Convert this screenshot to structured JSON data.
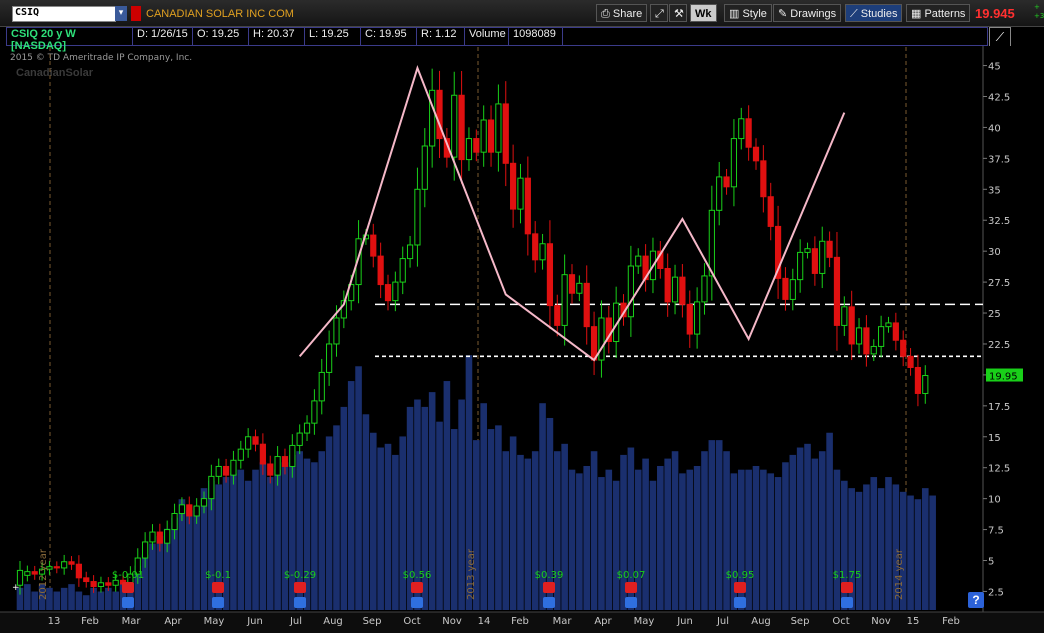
{
  "toolbar": {
    "symbol": "CSIQ",
    "company": "CANADIAN SOLAR INC COM",
    "share": "Share",
    "wk": "Wk",
    "style": "Style",
    "drawings": "Drawings",
    "studies": "Studies",
    "patterns": "Patterns",
    "last_price": "19.945",
    "right_tiny": "+\n+3"
  },
  "infobar": {
    "symbol": "CSIQ 20 y W [NASDAQ]",
    "date": "D: 1/26/15",
    "open": "O: 19.25",
    "high": "H: 20.37",
    "low": "L: 19.25",
    "close": "C: 19.95",
    "range": "R: 1.12",
    "vol_label": "Volume",
    "vol_value": "1098089"
  },
  "copyright": "2015 © TD Ameritrade IP Company, Inc.",
  "watermark": "CanadianSolar",
  "colors": {
    "up": "#19d019",
    "down": "#e01010",
    "volume": "#1a2f6e",
    "pattern": "#f5b8c8",
    "price_tag": "#19d019"
  },
  "chart_data": {
    "type": "candlestick",
    "ylim": [
      1.0,
      46.5
    ],
    "y_ticks": [
      "45",
      "42.5",
      "40",
      "37.5",
      "35",
      "32.5",
      "30",
      "27.5",
      "25",
      "22.5",
      "20",
      "17.5",
      "15",
      "12.5",
      "10",
      "7.5",
      "5",
      "2.5"
    ],
    "x_ticks": [
      "13",
      "Feb",
      "Mar",
      "Apr",
      "May",
      "Jun",
      "Jul",
      "Aug",
      "Sep",
      "Oct",
      "Nov",
      "14",
      "Feb",
      "Mar",
      "Apr",
      "May",
      "Jun",
      "Jul",
      "Aug",
      "Sep",
      "Oct",
      "Nov",
      "15",
      "Feb"
    ],
    "year_markers": [
      "2012 year",
      "2013 year",
      "2014 year"
    ],
    "current_price_label": "19.95",
    "candles": [
      [
        3.0,
        4.2
      ],
      [
        3.8,
        4.1
      ],
      [
        4.1,
        3.9
      ],
      [
        3.9,
        4.3
      ],
      [
        4.3,
        4.5
      ],
      [
        4.5,
        4.4
      ],
      [
        4.4,
        4.9
      ],
      [
        4.9,
        4.7
      ],
      [
        4.7,
        3.6
      ],
      [
        3.6,
        3.3
      ],
      [
        3.3,
        2.9
      ],
      [
        2.9,
        3.2
      ],
      [
        3.2,
        3.0
      ],
      [
        3.0,
        3.4
      ],
      [
        3.4,
        3.1
      ],
      [
        3.1,
        3.9
      ],
      [
        3.9,
        5.2
      ],
      [
        5.2,
        6.5
      ],
      [
        6.5,
        7.3
      ],
      [
        7.3,
        6.4
      ],
      [
        6.4,
        7.5
      ],
      [
        7.5,
        8.8
      ],
      [
        8.8,
        9.5
      ],
      [
        9.5,
        8.6
      ],
      [
        8.6,
        9.4
      ],
      [
        9.4,
        10.0
      ],
      [
        10.0,
        11.8
      ],
      [
        11.8,
        12.6
      ],
      [
        12.6,
        11.9
      ],
      [
        11.9,
        13.1
      ],
      [
        13.1,
        14.0
      ],
      [
        14.0,
        15.0
      ],
      [
        15.0,
        14.4
      ],
      [
        14.4,
        12.8
      ],
      [
        12.8,
        11.9
      ],
      [
        11.9,
        13.4
      ],
      [
        13.4,
        12.6
      ],
      [
        12.6,
        14.3
      ],
      [
        14.3,
        15.3
      ],
      [
        15.3,
        16.1
      ],
      [
        16.1,
        17.9
      ],
      [
        17.9,
        20.2
      ],
      [
        20.2,
        22.5
      ],
      [
        22.5,
        24.6
      ],
      [
        24.6,
        26.0
      ],
      [
        26.0,
        27.3
      ],
      [
        27.3,
        31.0
      ],
      [
        31.0,
        31.3
      ],
      [
        31.3,
        29.6
      ],
      [
        29.6,
        27.3
      ],
      [
        27.3,
        26.0
      ],
      [
        26.0,
        27.5
      ],
      [
        27.5,
        29.4
      ],
      [
        29.4,
        30.5
      ],
      [
        30.5,
        35.0
      ],
      [
        35.0,
        38.5
      ],
      [
        38.5,
        43.0
      ],
      [
        43.0,
        39.1
      ],
      [
        39.1,
        37.6
      ],
      [
        37.6,
        42.6
      ],
      [
        42.6,
        37.4
      ],
      [
        37.4,
        39.1
      ],
      [
        39.1,
        38.0
      ],
      [
        38.0,
        40.6
      ],
      [
        40.6,
        38.0
      ],
      [
        38.0,
        41.9
      ],
      [
        41.9,
        37.1
      ],
      [
        37.1,
        33.4
      ],
      [
        33.4,
        35.9
      ],
      [
        35.9,
        31.4
      ],
      [
        31.4,
        29.3
      ],
      [
        29.3,
        30.6
      ],
      [
        30.6,
        25.6
      ],
      [
        25.6,
        24.0
      ],
      [
        24.0,
        28.1
      ],
      [
        28.1,
        26.6
      ],
      [
        26.6,
        27.4
      ],
      [
        27.4,
        23.9
      ],
      [
        23.9,
        21.2
      ],
      [
        21.2,
        24.6
      ],
      [
        24.6,
        22.7
      ],
      [
        22.7,
        25.8
      ],
      [
        25.8,
        24.7
      ],
      [
        24.7,
        28.8
      ],
      [
        28.8,
        29.6
      ],
      [
        29.6,
        27.7
      ],
      [
        27.7,
        30.0
      ],
      [
        30.0,
        28.6
      ],
      [
        28.6,
        25.9
      ],
      [
        25.9,
        27.9
      ],
      [
        27.9,
        25.7
      ],
      [
        25.7,
        23.3
      ],
      [
        23.3,
        25.9
      ],
      [
        25.9,
        28.0
      ],
      [
        28.0,
        33.3
      ],
      [
        33.3,
        36.0
      ],
      [
        36.0,
        35.2
      ],
      [
        35.2,
        39.1
      ],
      [
        39.1,
        40.7
      ],
      [
        40.7,
        38.4
      ],
      [
        38.4,
        37.3
      ],
      [
        37.3,
        34.4
      ],
      [
        34.4,
        32.0
      ],
      [
        32.0,
        27.8
      ],
      [
        27.8,
        26.1
      ],
      [
        26.1,
        27.7
      ],
      [
        27.7,
        29.9
      ],
      [
        29.9,
        30.2
      ],
      [
        30.2,
        28.2
      ],
      [
        28.2,
        30.8
      ],
      [
        30.8,
        29.5
      ],
      [
        29.5,
        24.0
      ],
      [
        24.0,
        25.5
      ],
      [
        25.5,
        22.5
      ],
      [
        22.5,
        23.8
      ],
      [
        23.8,
        21.7
      ],
      [
        21.7,
        22.3
      ],
      [
        22.3,
        23.9
      ],
      [
        23.9,
        24.2
      ],
      [
        24.2,
        22.8
      ],
      [
        22.8,
        21.5
      ],
      [
        21.5,
        20.6
      ],
      [
        20.6,
        18.5
      ],
      [
        18.5,
        19.95
      ]
    ],
    "volume_rel": [
      0.06,
      0.07,
      0.05,
      0.07,
      0.06,
      0.05,
      0.06,
      0.07,
      0.05,
      0.04,
      0.06,
      0.05,
      0.06,
      0.05,
      0.07,
      0.08,
      0.12,
      0.15,
      0.18,
      0.2,
      0.22,
      0.25,
      0.3,
      0.27,
      0.28,
      0.33,
      0.35,
      0.34,
      0.36,
      0.37,
      0.38,
      0.35,
      0.38,
      0.4,
      0.36,
      0.38,
      0.4,
      0.42,
      0.43,
      0.41,
      0.4,
      0.43,
      0.47,
      0.5,
      0.55,
      0.62,
      0.66,
      0.53,
      0.48,
      0.44,
      0.45,
      0.42,
      0.47,
      0.55,
      0.57,
      0.55,
      0.59,
      0.51,
      0.62,
      0.49,
      0.57,
      0.69,
      0.46,
      0.56,
      0.49,
      0.5,
      0.43,
      0.47,
      0.42,
      0.41,
      0.43,
      0.56,
      0.52,
      0.43,
      0.45,
      0.38,
      0.37,
      0.39,
      0.43,
      0.36,
      0.38,
      0.35,
      0.42,
      0.44,
      0.38,
      0.41,
      0.35,
      0.39,
      0.41,
      0.43,
      0.37,
      0.38,
      0.39,
      0.43,
      0.46,
      0.46,
      0.43,
      0.37,
      0.38,
      0.38,
      0.39,
      0.38,
      0.37,
      0.36,
      0.4,
      0.42,
      0.44,
      0.45,
      0.41,
      0.43,
      0.48,
      0.38,
      0.35,
      0.33,
      0.32,
      0.34,
      0.36,
      0.33,
      0.36,
      0.34,
      0.32,
      0.31,
      0.3,
      0.33,
      0.31
    ],
    "support_lines": [
      25.7,
      21.5
    ],
    "pattern_points": [
      [
        38,
        21.5
      ],
      [
        44,
        25.7
      ],
      [
        54,
        44.8
      ],
      [
        66,
        26.5
      ],
      [
        78,
        21.2
      ],
      [
        90,
        32.6
      ],
      [
        99,
        22.9
      ],
      [
        112,
        41.2
      ]
    ],
    "earnings": [
      "$-0.01",
      "$-0.1",
      "$-0.29",
      "$0.56",
      "$0.39",
      "$0.07",
      "$0.95",
      "$1.75"
    ]
  }
}
